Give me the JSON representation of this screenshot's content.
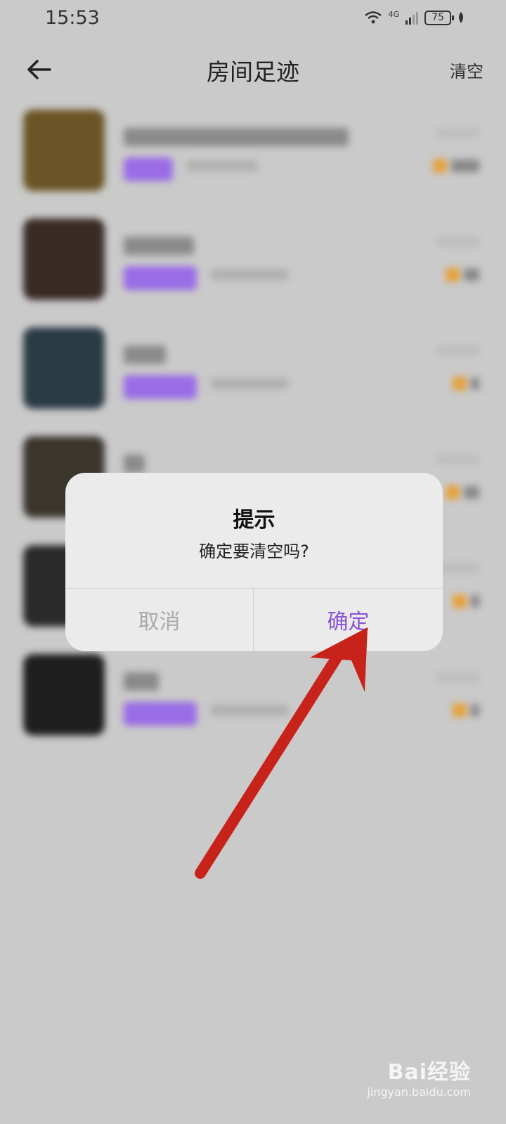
{
  "status_bar": {
    "time": "15:53",
    "network": "4G",
    "battery": "75"
  },
  "header": {
    "title": "房间足迹",
    "clear_label": "清空"
  },
  "list": {
    "items": [
      {
        "thumb_color": "#6b5526",
        "name_width": 320,
        "tag_width": 50,
        "sub_width": 100,
        "score_width": 40
      },
      {
        "thumb_color": "#3a2a25",
        "name_width": 100,
        "tag_width": 84,
        "sub_width": 110,
        "score_width": 22
      },
      {
        "thumb_color": "#2a3a45",
        "name_width": 60,
        "tag_width": 84,
        "sub_width": 110,
        "score_width": 12
      },
      {
        "thumb_color": "#3a362e",
        "name_width": 30,
        "tag_width": 84,
        "sub_width": 110,
        "score_width": 22
      },
      {
        "thumb_color": "#2a2a2a",
        "name_width": 80,
        "tag_width": 84,
        "sub_width": 110,
        "score_width": 12
      },
      {
        "thumb_color": "#1e1e1e",
        "name_width": 50,
        "tag_width": 84,
        "sub_width": 110,
        "score_width": 12
      }
    ]
  },
  "dialog": {
    "title": "提示",
    "message": "确定要清空吗?",
    "cancel_label": "取消",
    "confirm_label": "确定"
  },
  "watermark": {
    "logo": "Bai经验",
    "url": "jingyan.baidu.com"
  },
  "colors": {
    "accent": "#8a55d6",
    "arrow": "#c8231b",
    "tag": "#9a6ce6"
  }
}
